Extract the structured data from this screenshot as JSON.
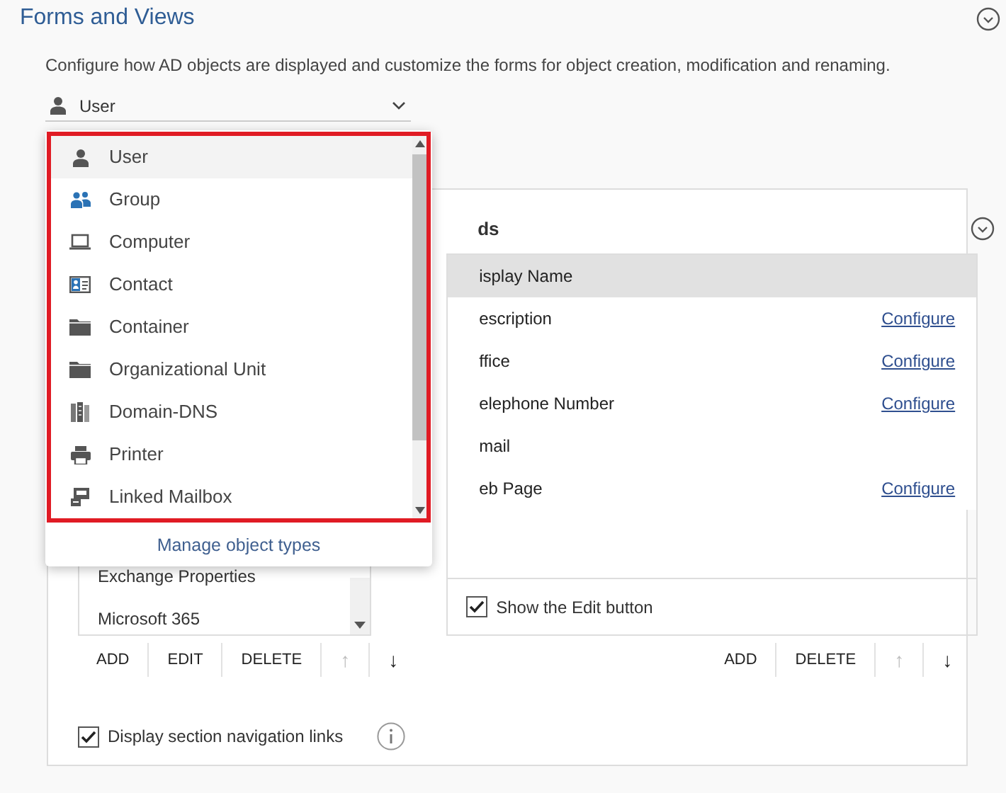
{
  "section": {
    "title": "Forms and Views",
    "description": "Configure how AD objects are displayed and customize the forms for object creation, modification and renaming."
  },
  "object_type_select": {
    "value": "User",
    "kind": "user",
    "expanded": true
  },
  "object_type_menu": {
    "items": [
      {
        "label": "User",
        "kind": "user",
        "selected": true
      },
      {
        "label": "Group",
        "kind": "group",
        "selected": false
      },
      {
        "label": "Computer",
        "kind": "computer",
        "selected": false
      },
      {
        "label": "Contact",
        "kind": "contact",
        "selected": false
      },
      {
        "label": "Container",
        "kind": "folder",
        "selected": false
      },
      {
        "label": "Organizational Unit",
        "kind": "folder",
        "selected": false
      },
      {
        "label": "Domain-DNS",
        "kind": "domain",
        "selected": false
      },
      {
        "label": "Printer",
        "kind": "printer",
        "selected": false
      },
      {
        "label": "Linked Mailbox",
        "kind": "mailbox",
        "selected": false
      }
    ],
    "footer_link": "Manage object types"
  },
  "sections_list": {
    "items": [
      {
        "label": "Exchange Properties"
      },
      {
        "label": "Microsoft 365"
      }
    ],
    "buttons": [
      {
        "label": "ADD",
        "disabled": false
      },
      {
        "label": "EDIT",
        "disabled": false
      },
      {
        "label": "DELETE",
        "disabled": false
      },
      {
        "label": "↑",
        "disabled": true
      },
      {
        "label": "↓",
        "disabled": false
      }
    ]
  },
  "fields": {
    "heading": "ds",
    "rows": [
      {
        "label": "isplay Name",
        "selected": true
      },
      {
        "label": "escription",
        "selected": false,
        "action": "Configure"
      },
      {
        "label": "ffice",
        "selected": false,
        "action": "Configure"
      },
      {
        "label": "elephone Number",
        "selected": false,
        "action": "Configure"
      },
      {
        "label": "mail",
        "selected": false
      },
      {
        "label": "eb Page",
        "selected": false,
        "action": "Configure"
      }
    ],
    "show_edit_button": {
      "label": "Show the Edit button",
      "checked": true
    },
    "buttons": [
      {
        "label": "ADD",
        "disabled": false
      },
      {
        "label": "DELETE",
        "disabled": false
      },
      {
        "label": "↑",
        "disabled": true
      },
      {
        "label": "↓",
        "disabled": false
      }
    ]
  },
  "navigation_links": {
    "label": "Display section navigation links",
    "checked": true
  }
}
